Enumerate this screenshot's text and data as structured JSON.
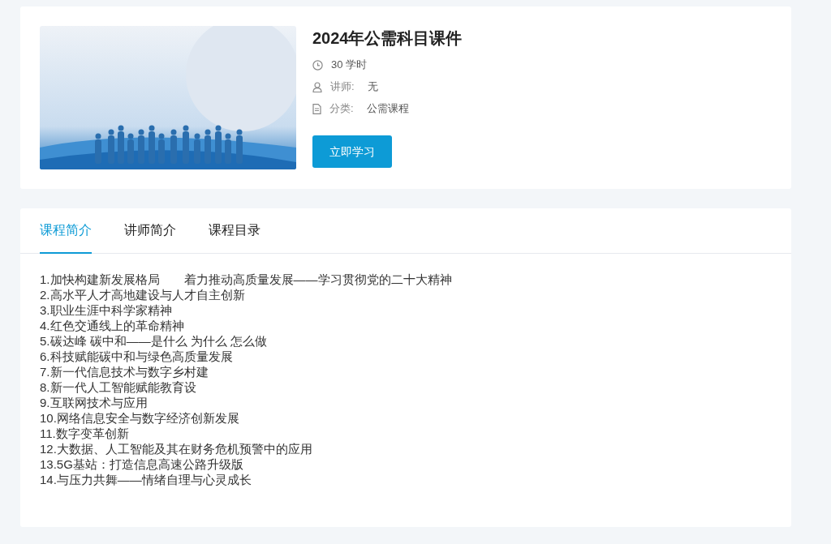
{
  "course": {
    "title": "2024年公需科目课件",
    "meta": [
      {
        "kind": "hours",
        "value": "30 学时"
      },
      {
        "kind": "teacher",
        "label": "讲师:",
        "value": "无"
      },
      {
        "kind": "category",
        "label": "分类:",
        "value": "公需课程"
      }
    ],
    "action": "立即学习"
  },
  "tabs": [
    {
      "label": "课程简介",
      "selected": true
    },
    {
      "label": "讲师简介",
      "selected": false
    },
    {
      "label": "课程目录",
      "selected": false
    }
  ],
  "outline": [
    "1.加快构建新发展格局　　着力推动高质量发展——学习贯彻党的二十大精神",
    "2.高水平人才高地建设与人才自主创新",
    "3.职业生涯中科学家精神",
    "4.红色交通线上的革命精神",
    "5.碳达峰 碳中和——是什么 为什么 怎么做",
    "6.科技赋能碳中和与绿色高质量发展",
    "7.新一代信息技术与数字乡村建",
    "8.新一代人工智能赋能教育设",
    "9.互联网技术与应用",
    "10.网络信息安全与数字经济创新发展",
    "11.数字变革创新",
    "12.大数据、人工智能及其在财务危机预警中的应用",
    "13.5G基站：打造信息高速公路升级版",
    "14.与压力共舞——情绪自理与心灵成长"
  ]
}
